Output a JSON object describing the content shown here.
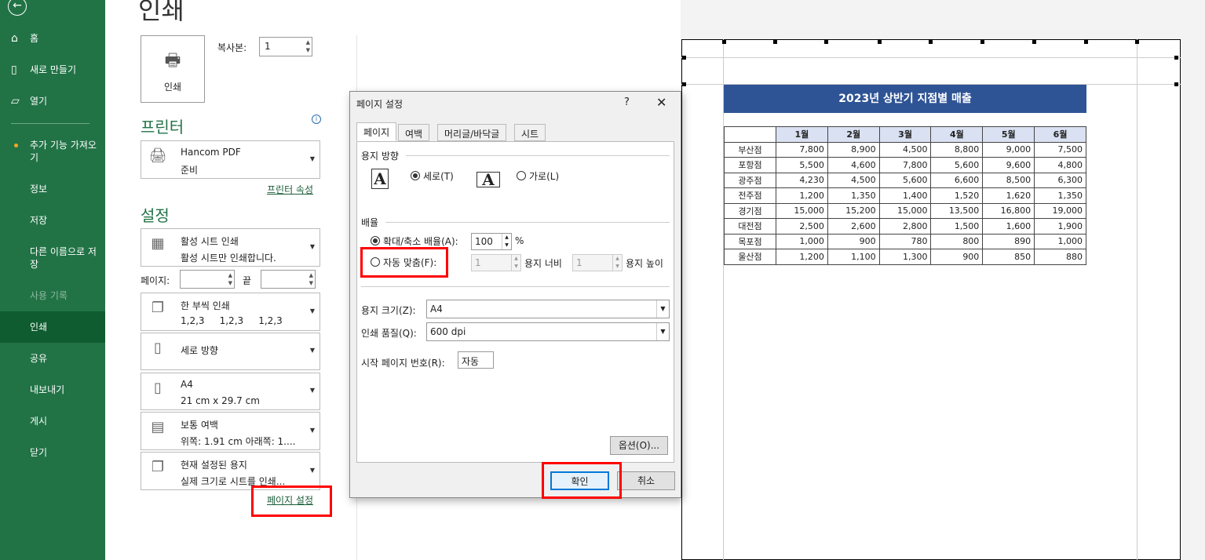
{
  "sidebar": {
    "items": [
      {
        "label": "홈",
        "icon": "home-icon"
      },
      {
        "label": "새로 만들기",
        "icon": "new-doc-icon"
      },
      {
        "label": "열기",
        "icon": "folder-open-icon"
      },
      {
        "label": "추가 기능 가져오기"
      },
      {
        "label": "정보"
      },
      {
        "label": "저장"
      },
      {
        "label": "다른 이름으로 저장"
      },
      {
        "label": "사용 기록"
      },
      {
        "label": "인쇄"
      },
      {
        "label": "공유"
      },
      {
        "label": "내보내기"
      },
      {
        "label": "게시"
      },
      {
        "label": "닫기"
      }
    ],
    "accent": "#217346"
  },
  "print": {
    "title": "인쇄",
    "button_label": "인쇄",
    "copies_label": "복사본:",
    "copies_value": "1",
    "printer_heading": "프린터",
    "printer_name": "Hancom PDF",
    "printer_status": "준비",
    "printer_props_link": "프린터 속성",
    "settings_heading": "설정",
    "sheet_option": {
      "l1": "활성 시트 인쇄",
      "l2": "활성 시트만 인쇄합니다."
    },
    "pages_label": "페이지:",
    "to_label": "끝",
    "collate_option": {
      "l1": "한 부씩 인쇄",
      "l2": "1,2,3     1,2,3     1,2,3"
    },
    "orientation_option": {
      "l1": "세로 방향"
    },
    "paper_option": {
      "l1": "A4",
      "l2": "21 cm x 29.7 cm"
    },
    "margins_option": {
      "l1": "보통 여백",
      "l2": "위쪽: 1.91 cm 아래쪽: 1...."
    },
    "scaling_option": {
      "l1": "현재 설정된 용지",
      "l2": "실제 크기로 시트를 인쇄..."
    },
    "page_setup_link": "페이지 설정"
  },
  "dialog": {
    "title": "페이지 설정",
    "help": "?",
    "tabs": [
      "페이지",
      "여백",
      "머리글/바닥글",
      "시트"
    ],
    "orientation_group": "용지 방향",
    "portrait_label": "세로(T)",
    "landscape_label": "가로(L)",
    "scaling_group": "배율",
    "adjust_label": "확대/축소 배율(A):",
    "adjust_value": "100",
    "percent": "%",
    "fit_label": "자동 맞춤(F):",
    "fit_width_value": "1",
    "fit_width_label": "용지 너비",
    "fit_height_value": "1",
    "fit_height_label": "용지 높이",
    "paper_size_label": "용지 크기(Z):",
    "paper_size_value": "A4",
    "quality_label": "인쇄 품질(Q):",
    "quality_value": "600 dpi",
    "first_page_label": "시작 페이지 번호(R):",
    "first_page_value": "자동",
    "options_button": "옵션(O)...",
    "ok_button": "확인",
    "cancel_button": "취소"
  },
  "sheet": {
    "title": "2023년 상반기 지점별 매출",
    "header": [
      "",
      "1월",
      "2월",
      "3월",
      "4월",
      "5월",
      "6월"
    ],
    "rows": [
      [
        "부산점",
        "7,800",
        "8,900",
        "4,500",
        "8,800",
        "9,000",
        "7,500"
      ],
      [
        "포항점",
        "5,500",
        "4,600",
        "7,800",
        "5,600",
        "9,600",
        "4,800"
      ],
      [
        "광주점",
        "4,230",
        "4,500",
        "5,600",
        "6,600",
        "8,500",
        "6,300"
      ],
      [
        "전주점",
        "1,200",
        "1,350",
        "1,400",
        "1,520",
        "1,620",
        "1,350"
      ],
      [
        "경기점",
        "15,000",
        "15,200",
        "15,000",
        "13,500",
        "16,800",
        "19,000"
      ],
      [
        "대전점",
        "2,500",
        "2,600",
        "2,800",
        "1,500",
        "1,600",
        "1,900"
      ],
      [
        "목포점",
        "1,000",
        "900",
        "780",
        "800",
        "890",
        "1,000"
      ],
      [
        "울산점",
        "1,200",
        "1,100",
        "1,300",
        "900",
        "850",
        "880"
      ]
    ]
  }
}
